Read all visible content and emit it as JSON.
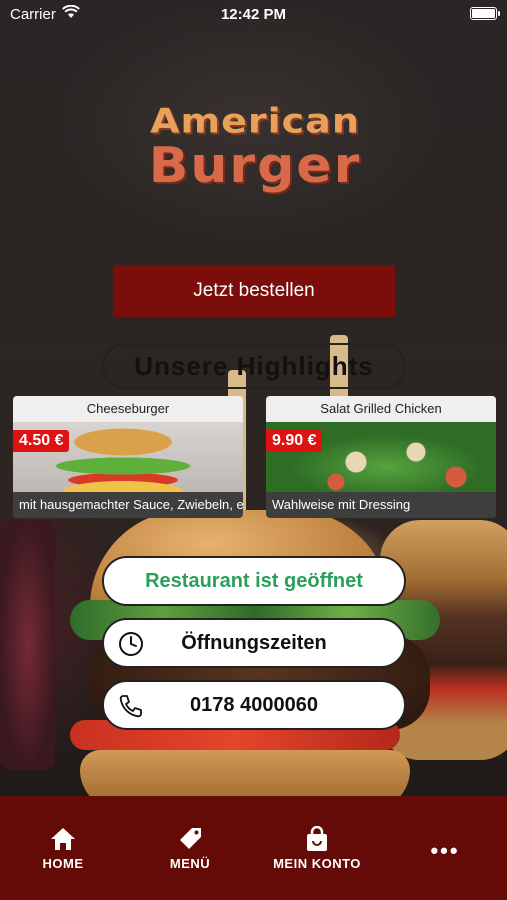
{
  "status_bar": {
    "carrier": "Carrier",
    "time": "12:42 PM"
  },
  "logo": {
    "line1": "American",
    "line2": "Burger"
  },
  "order_button": {
    "label": "Jetzt bestellen"
  },
  "highlights": {
    "title": "Unsere Highlights",
    "items": [
      {
        "name": "Cheeseburger",
        "price": "4.50 €",
        "description": "mit hausgemachter Sauce, Zwiebeln, ei..."
      },
      {
        "name": "Salat Grilled Chicken",
        "price": "9.90 €",
        "description": "Wahlweise mit Dressing"
      }
    ]
  },
  "info": {
    "status": "Restaurant ist geöffnet",
    "hours_label": "Öffnungszeiten",
    "phone": "0178 4000060"
  },
  "tabbar": {
    "items": [
      {
        "label": "HOME",
        "icon": "home-icon"
      },
      {
        "label": "MENÜ",
        "icon": "tag-icon"
      },
      {
        "label": "MEIN KONTO",
        "icon": "shopping-bag-icon"
      },
      {
        "label": "•••",
        "icon": "more-icon"
      }
    ]
  },
  "colors": {
    "brand_dark_red": "#650b07",
    "button_red": "#7b0d0a",
    "price_red": "#e01111",
    "open_green": "#2aa05a"
  }
}
